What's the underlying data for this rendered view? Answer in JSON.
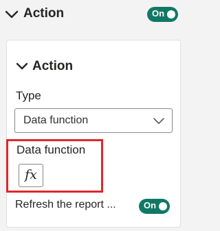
{
  "outer_section": {
    "title": "Action",
    "toggle_label": "On"
  },
  "inner_section": {
    "title": "Action"
  },
  "type_field": {
    "label": "Type",
    "selected_value": "Data function"
  },
  "data_function_field": {
    "label": "Data function",
    "button_label": "fx"
  },
  "refresh_option": {
    "label": "Refresh the report ...",
    "toggle_label": "On"
  },
  "colors": {
    "toggle_on": "#117865",
    "highlight_border": "#e0252b"
  },
  "icons": [
    "chevron-down-icon",
    "fx-icon"
  ]
}
